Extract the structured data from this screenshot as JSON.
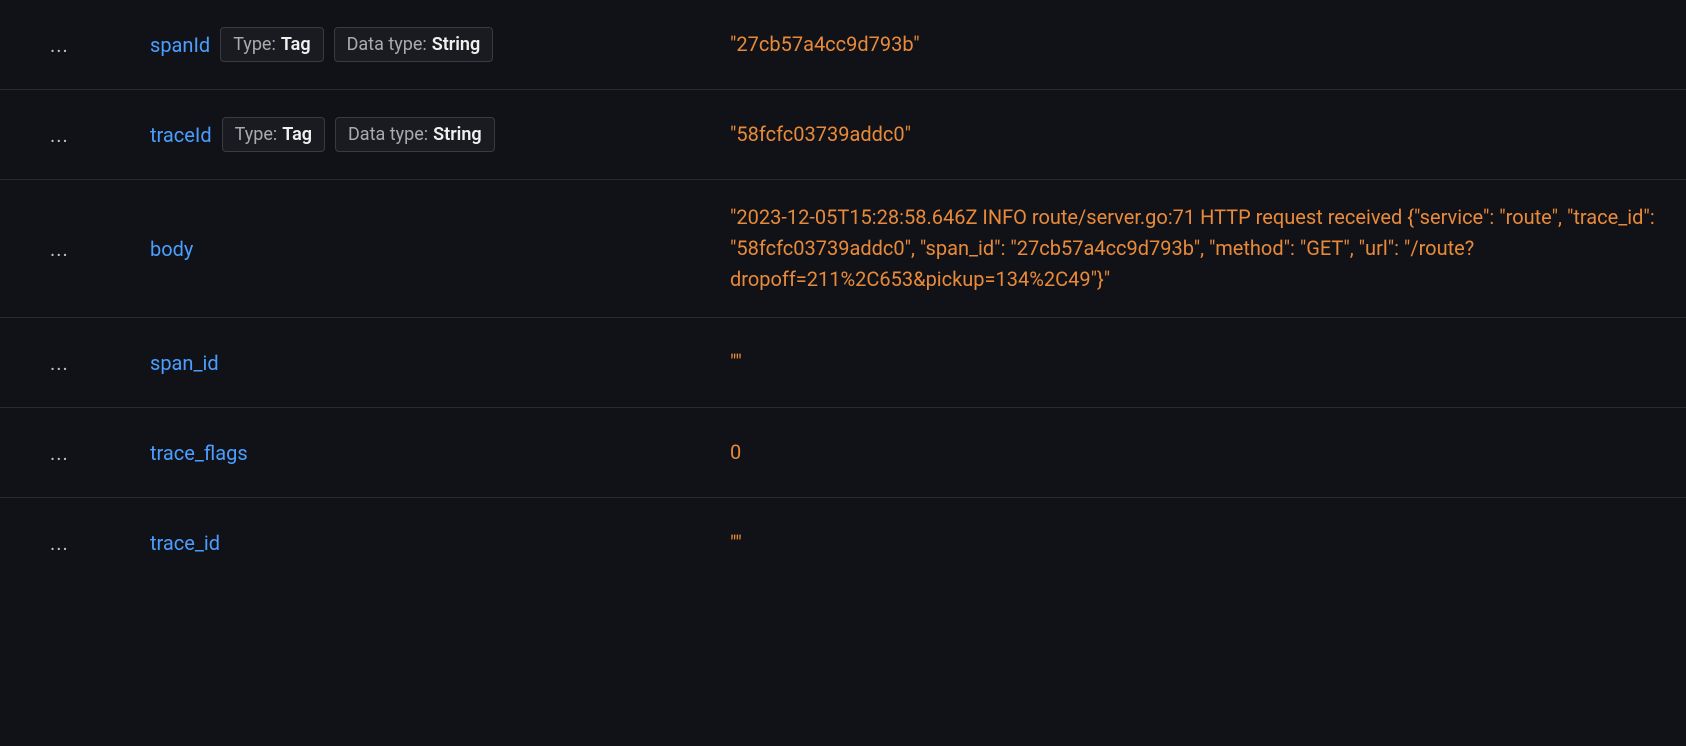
{
  "actions_label": "...",
  "badges": {
    "type_label": "Type:",
    "type_value": "Tag",
    "datatype_label": "Data type:",
    "datatype_value": "String"
  },
  "rows": [
    {
      "field": "spanId",
      "has_badges": true,
      "value": "\"27cb57a4cc9d793b\""
    },
    {
      "field": "traceId",
      "has_badges": true,
      "value": "\"58fcfc03739addc0\""
    },
    {
      "field": "body",
      "has_badges": false,
      "value": "\"2023-12-05T15:28:58.646Z INFO route/server.go:71 HTTP request received {\"service\": \"route\", \"trace_id\": \"58fcfc03739addc0\", \"span_id\": \"27cb57a4cc9d793b\", \"method\": \"GET\", \"url\": \"/route?dropoff=211%2C653&pickup=134%2C49\"}\""
    },
    {
      "field": "span_id",
      "has_badges": false,
      "value": "\"\""
    },
    {
      "field": "trace_flags",
      "has_badges": false,
      "value": "0"
    },
    {
      "field": "trace_id",
      "has_badges": false,
      "value": "\"\""
    }
  ]
}
